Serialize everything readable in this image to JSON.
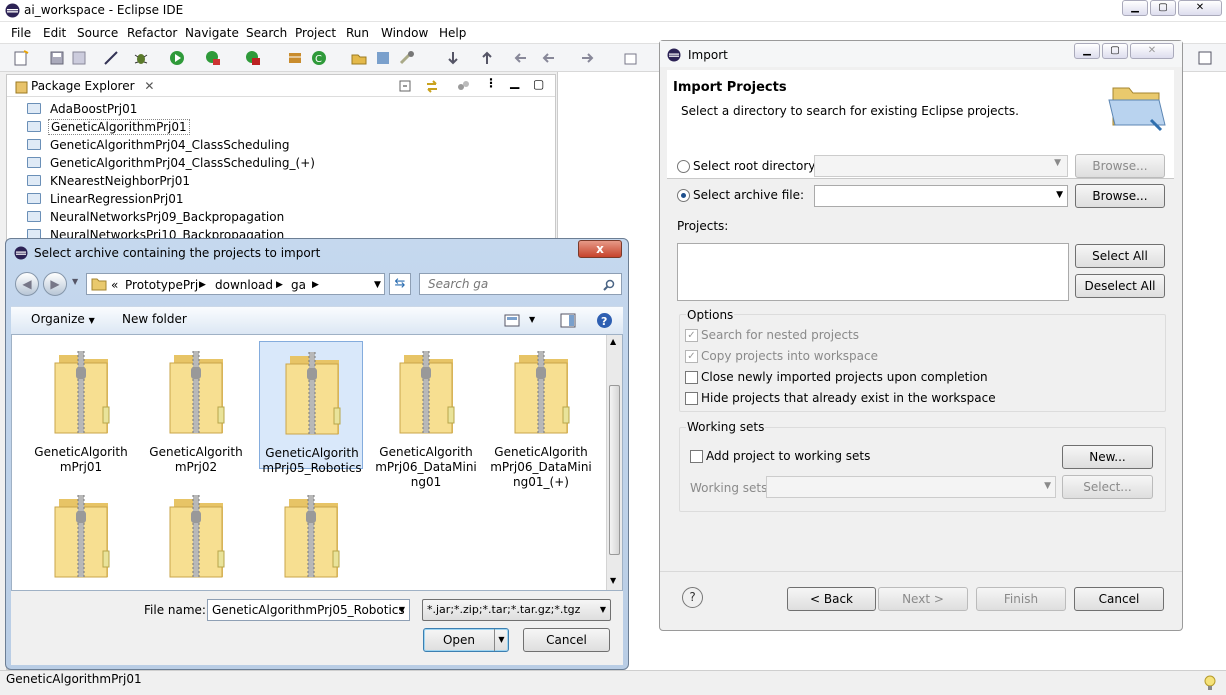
{
  "eclipse": {
    "title": "ai_workspace - Eclipse IDE",
    "menu": [
      "File",
      "Edit",
      "Source",
      "Refactor",
      "Navigate",
      "Search",
      "Project",
      "Run",
      "Window",
      "Help"
    ],
    "package_explorer": {
      "tab_label": "Package Explorer",
      "projects": [
        "AdaBoostPrj01",
        "GeneticAlgorithmPrj01",
        "GeneticAlgorithmPrj04_ClassScheduling",
        "GeneticAlgorithmPrj04_ClassScheduling_(+)",
        "KNearestNeighborPrj01",
        "LinearRegressionPrj01",
        "NeuralNetworksPrj09_Backpropagation",
        "NeuralNetworksPrj10_Backpropagation"
      ],
      "selected": "GeneticAlgorithmPrj01"
    },
    "status": "GeneticAlgorithmPrj01"
  },
  "file_dialog": {
    "title": "Select archive containing the projects to import",
    "address": {
      "prefix": "«",
      "parts": [
        "PrototypePrj",
        "download",
        "ga"
      ]
    },
    "search_placeholder": "Search ga",
    "organize_label": "Organize",
    "new_folder_label": "New folder",
    "files": [
      {
        "name": "GeneticAlgorithmPrj01",
        "selected": false
      },
      {
        "name": "GeneticAlgorithmPrj02",
        "selected": false
      },
      {
        "name": "GeneticAlgorithmPrj05_Robotics",
        "selected": true
      },
      {
        "name": "GeneticAlgorithmPrj06_DataMining01",
        "selected": false
      },
      {
        "name": "GeneticAlgorithmPrj06_DataMining01_(+)",
        "selected": false
      },
      {
        "name": "",
        "selected": false
      },
      {
        "name": "",
        "selected": false
      },
      {
        "name": "",
        "selected": false
      }
    ],
    "file_names_shown": [
      "GeneticAlgorith mPrj01",
      "GeneticAlgorith mPrj02",
      "GeneticAlgorith mPrj05_Robotics",
      "GeneticAlgorith mPrj06_DataMini ng01",
      "GeneticAlgorith mPrj06_DataMini ng01_(+)"
    ],
    "file_name_label": "File name:",
    "file_name_value": "GeneticAlgorithmPrj05_Robotics",
    "filter_value": "*.jar;*.zip;*.tar;*.tar.gz;*.tgz",
    "open_label": "Open",
    "cancel_label": "Cancel",
    "close_label": "x"
  },
  "import_dialog": {
    "title": "Import",
    "heading": "Import Projects",
    "description": "Select a directory to search for existing Eclipse projects.",
    "root_dir_label": "Select root directory:",
    "archive_label": "Select archive file:",
    "archive_selected": true,
    "browse_label": "Browse...",
    "projects_label": "Projects:",
    "select_all_label": "Select All",
    "deselect_all_label": "Deselect All",
    "options_label": "Options",
    "options": [
      {
        "label": "Search for nested projects",
        "checked": true,
        "enabled": false
      },
      {
        "label": "Copy projects into workspace",
        "checked": true,
        "enabled": false
      },
      {
        "label": "Close newly imported projects upon completion",
        "checked": false,
        "enabled": true
      },
      {
        "label": "Hide projects that already exist in the workspace",
        "checked": false,
        "enabled": true
      }
    ],
    "working_sets_label": "Working sets",
    "add_to_ws_label": "Add project to working sets",
    "new_label": "New...",
    "ws_field_label": "Working sets:",
    "select_label": "Select...",
    "back_label": "< Back",
    "next_label": "Next >",
    "finish_label": "Finish",
    "cancel_label": "Cancel",
    "help_label": "?"
  }
}
